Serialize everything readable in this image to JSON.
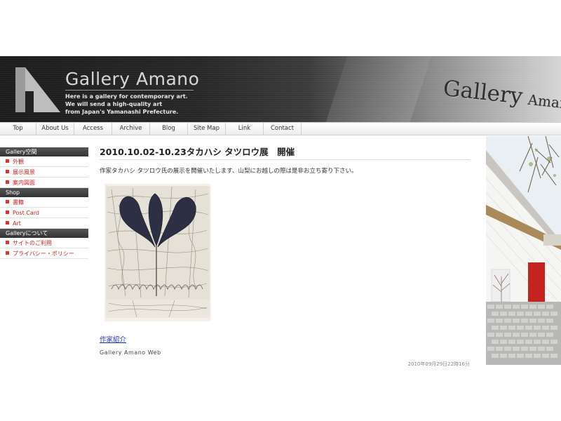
{
  "header": {
    "brand": "Gallery Amano",
    "tagline": [
      "Here is a gallery for contemporary art.",
      "We will send a high-quality art",
      "from Japan's Yamanashi Prefecture."
    ],
    "sign_word1": "Gallery",
    "sign_word2": "Amano"
  },
  "nav": {
    "items": [
      "Top",
      "About Us",
      "Access",
      "Archive",
      "Blog",
      "Site Map",
      "Link",
      "Contact"
    ]
  },
  "sidebar": {
    "sections": [
      {
        "heading": "Gallery空間",
        "items": [
          "外観",
          "展示風景",
          "案内図面"
        ]
      },
      {
        "heading": "Shop",
        "items": [
          "書籍",
          "Post Card",
          "Art"
        ]
      },
      {
        "heading": "Galleryについて",
        "items": [
          "サイトのご利用",
          "プライバシー・ポリシー"
        ]
      }
    ]
  },
  "post": {
    "title": "2010.10.02-10.23タカハシ タツロウ展　開催",
    "body": "作家タカハシ タツロウ氏の展示を開催いたします、山梨にお越しの際は是非お立ち寄り下さい。",
    "author_link": "作家紹介",
    "web_label": "Gallery Amano Web",
    "date": "2010年09月29日22時16分"
  },
  "colors": {
    "accent_red": "#cc2222",
    "link_blue": "#1a33cc",
    "sidebar_heading_bg": "#444444"
  }
}
